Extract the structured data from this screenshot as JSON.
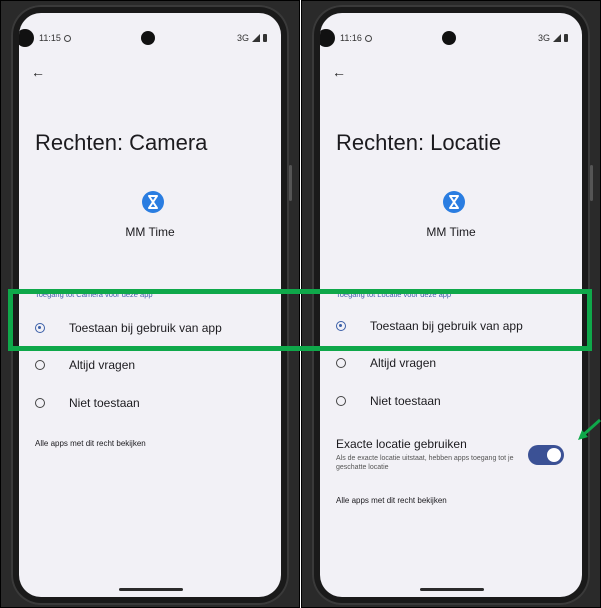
{
  "left_screen": {
    "status_time": "11:15",
    "network": "3G",
    "title": "Rechten: Camera",
    "app_name": "MM Time",
    "section_label": "Toegang tot Camera voor deze app",
    "options": [
      {
        "label": "Toestaan bij gebruik van app",
        "selected": true
      },
      {
        "label": "Altijd vragen",
        "selected": false
      },
      {
        "label": "Niet toestaan",
        "selected": false
      }
    ],
    "see_all_link": "Alle apps met dit recht bekijken"
  },
  "right_screen": {
    "status_time": "11:16",
    "network": "3G",
    "title": "Rechten: Locatie",
    "app_name": "MM Time",
    "section_label": "Toegang tot Locatie voor deze app",
    "options": [
      {
        "label": "Toestaan bij gebruik van app",
        "selected": true
      },
      {
        "label": "Altijd vragen",
        "selected": false
      },
      {
        "label": "Niet toestaan",
        "selected": false
      }
    ],
    "precise_location": {
      "title": "Exacte locatie gebruiken",
      "description": "Als de exacte locatie uitstaat, hebben apps toegang tot je geschatte locatie",
      "enabled": true
    },
    "see_all_link": "Alle apps met dit recht bekijken"
  },
  "icons": {
    "back": "arrow-left-icon",
    "app": "hourglass-icon",
    "alarm": "alarm-icon",
    "signal": "signal-icon",
    "battery": "battery-icon",
    "callout": "arrow-callout-icon"
  },
  "colors": {
    "highlight": "#0fa84a",
    "accent": "#3b5fa8",
    "app_icon": "#2a7de1",
    "toggle_on": "#3b5195",
    "screen_bg": "#f2f1f6"
  }
}
